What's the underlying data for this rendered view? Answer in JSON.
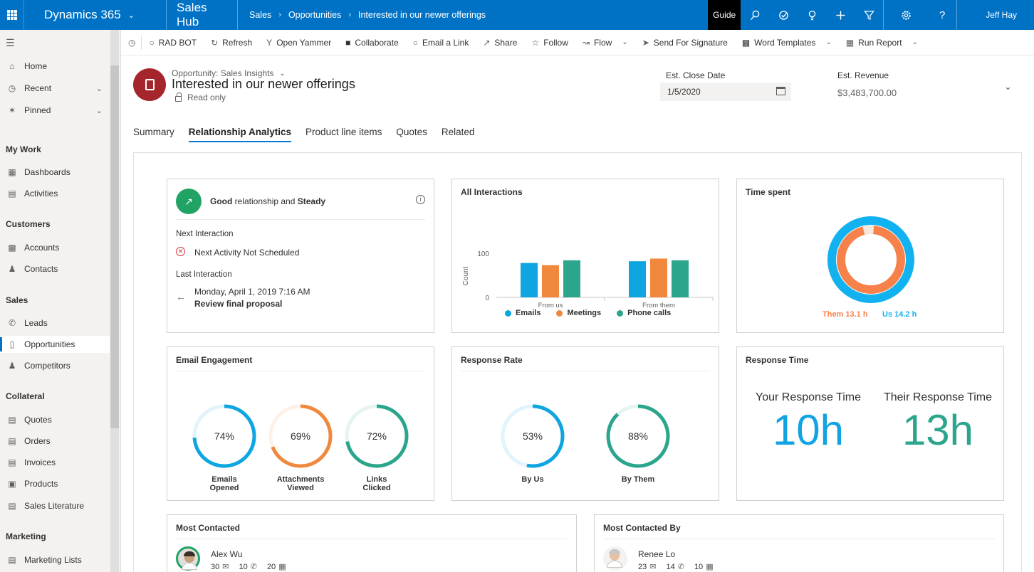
{
  "topbar": {
    "app_name": "Dynamics 365",
    "hub_name": "Sales Hub",
    "breadcrumbs": [
      "Sales",
      "Opportunities",
      "Interested in our newer offerings"
    ],
    "guide_label": "Guide",
    "user_name": "Jeff Hay"
  },
  "sidebar": {
    "nav": [
      {
        "label": "Home",
        "icon": "home-icon"
      },
      {
        "label": "Recent",
        "icon": "clock-icon"
      },
      {
        "label": "Pinned",
        "icon": "pin-icon"
      }
    ],
    "groups": [
      {
        "title": "My Work",
        "items": [
          "Dashboards",
          "Activities"
        ]
      },
      {
        "title": "Customers",
        "items": [
          "Accounts",
          "Contacts"
        ]
      },
      {
        "title": "Sales",
        "items": [
          "Leads",
          "Opportunities",
          "Competitors"
        ]
      },
      {
        "title": "Collateral",
        "items": [
          "Quotes",
          "Orders",
          "Invoices",
          "Products",
          "Sales Literature"
        ]
      },
      {
        "title": "Marketing",
        "items": [
          "Marketing Lists"
        ]
      }
    ],
    "active_item": "Opportunities"
  },
  "commands": [
    {
      "label": "RAD BOT",
      "icon": "bot-icon"
    },
    {
      "label": "Refresh",
      "icon": "refresh-icon"
    },
    {
      "label": "Open Yammer",
      "icon": "yammer-icon"
    },
    {
      "label": "Collaborate",
      "icon": "teams-icon"
    },
    {
      "label": "Email a Link",
      "icon": "link-icon"
    },
    {
      "label": "Share",
      "icon": "share-icon"
    },
    {
      "label": "Follow",
      "icon": "star-icon"
    },
    {
      "label": "Flow",
      "icon": "flow-icon"
    },
    {
      "label": "Send For Signature",
      "icon": "signature-icon"
    },
    {
      "label": "Word Templates",
      "icon": "word-icon"
    },
    {
      "label": "Run Report",
      "icon": "report-icon"
    }
  ],
  "record": {
    "form_label": "Opportunity: Sales Insights",
    "title": "Interested in our newer offerings",
    "read_only": "Read only",
    "close_date_label": "Est. Close Date",
    "close_date": "1/5/2020",
    "revenue_label": "Est. Revenue",
    "revenue": "$3,483,700.00"
  },
  "tabs": [
    "Summary",
    "Relationship Analytics",
    "Product line items",
    "Quotes",
    "Related"
  ],
  "active_tab": "Relationship Analytics",
  "relationship": {
    "health_word": "Good",
    "health_mid": "relationship and",
    "trend_word": "Steady",
    "next_label": "Next Interaction",
    "next_value": "Next Activity Not Scheduled",
    "last_label": "Last Interaction",
    "last_date": "Monday, April 1, 2019 7:16 AM",
    "last_subject": "Review final proposal"
  },
  "interactions": {
    "title": "All Interactions",
    "ylabel": "Count",
    "yticks": [
      "100",
      "0"
    ],
    "colors": {
      "Emails": "#0ea5e0",
      "Meetings": "#f0883e",
      "Phone calls": "#2ca58d"
    }
  },
  "time_spent": {
    "title": "Time spent",
    "them_label": "Them 13.1 h",
    "us_label": "Us 14.2 h",
    "them_color": "#f7814a",
    "us_color": "#12b2f0"
  },
  "email_engagement": {
    "title": "Email Engagement",
    "items": [
      {
        "pct": 74,
        "text": "74%",
        "caption": [
          "Emails",
          "Opened"
        ],
        "color": "#0ea5e0"
      },
      {
        "pct": 69,
        "text": "69%",
        "caption": [
          "Attachments",
          "Viewed"
        ],
        "color": "#f0883e"
      },
      {
        "pct": 72,
        "text": "72%",
        "caption": [
          "Links",
          "Clicked"
        ],
        "color": "#2ca58d"
      }
    ]
  },
  "response_rate": {
    "title": "Response Rate",
    "items": [
      {
        "pct": 53,
        "text": "53%",
        "caption": "By Us",
        "color": "#0ea5e0"
      },
      {
        "pct": 88,
        "text": "88%",
        "caption": "By Them",
        "color": "#2ca58d"
      }
    ]
  },
  "response_time": {
    "title": "Response Time",
    "yours_label": "Your Response Time",
    "yours_value": "10h",
    "theirs_label": "Their Response Time",
    "theirs_value": "13h"
  },
  "most_contacted": {
    "title": "Most Contacted",
    "name": "Alex Wu",
    "emails": "30",
    "calls": "10",
    "meetings": "20"
  },
  "most_contacted_by": {
    "title": "Most Contacted By",
    "name": "Renee Lo",
    "emails": "23",
    "calls": "14",
    "meetings": "10"
  },
  "chart_data": {
    "type": "bar",
    "title": "All Interactions",
    "ylabel": "Count",
    "categories": [
      "From us",
      "From them"
    ],
    "series": [
      {
        "name": "Emails",
        "values": [
          78,
          82
        ]
      },
      {
        "name": "Meetings",
        "values": [
          73,
          88
        ]
      },
      {
        "name": "Phone calls",
        "values": [
          84,
          84
        ]
      }
    ],
    "ylim": [
      0,
      100
    ],
    "legend": "bottom"
  }
}
